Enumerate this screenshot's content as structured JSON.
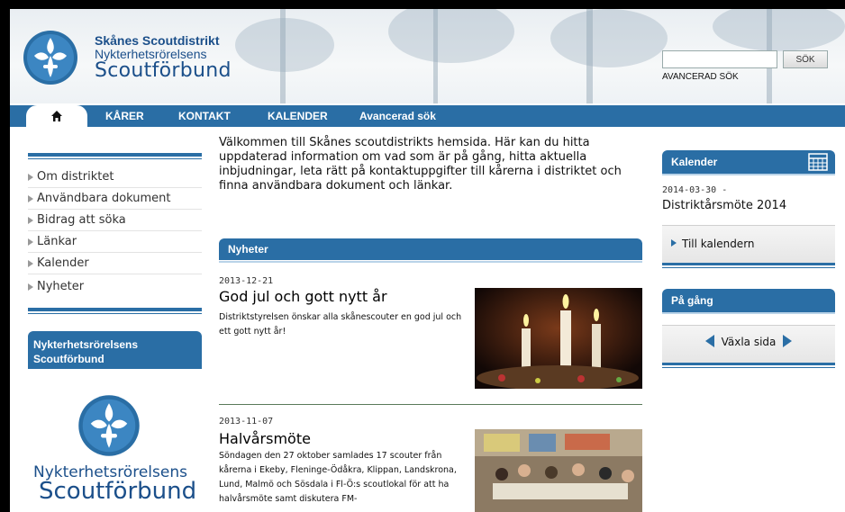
{
  "site": {
    "logo_line1": "Skånes Scoutdistrikt",
    "logo_line2": "Nykterhetsrörelsens",
    "logo_line3": "Scoutförbund"
  },
  "search": {
    "button_label": "SÖK",
    "placeholder": "",
    "advanced_label": "AVANCERAD SÖK"
  },
  "nav": {
    "home_icon": "home-icon",
    "items": [
      "KÅRER",
      "KONTAKT",
      "KALENDER",
      "Avancerad sök"
    ]
  },
  "sidebar": {
    "items": [
      "Om distriktet",
      "Användbara dokument",
      "Bidrag att söka",
      "Länkar",
      "Kalender",
      "Nyheter"
    ],
    "box_title": "Nykterhetsrörelsens Scoutförbund",
    "box_logo_line1": "Nykterhetsrörelsens",
    "box_logo_line2": "Scoutförbund"
  },
  "main": {
    "welcome": "Välkommen till Skånes scoutdistrikts hemsida. Här kan du hitta uppdaterad information om vad som är på gång, hitta aktuella inbjudningar, leta rätt på kontaktuppgifter till kårerna i distriktet och finna användbara dokument och länkar.",
    "news_header": "Nyheter",
    "news": [
      {
        "date": "2013-12-21",
        "title": "God jul och gott nytt år",
        "body": "Distriktstyrelsen önskar alla skånescouter en god jul och ett gott nytt år!"
      },
      {
        "date": "2013-11-07",
        "title": "Halvårsmöte",
        "body": "Söndagen den 27 oktober samlades 17 scouter från kårerna i Ekeby, Fleninge-Ödåkra, Klippan, Landskrona, Lund, Malmö och Sösdala i Fl-Ö:s scoutlokal för att ha halvårsmöte samt diskutera FM-"
      }
    ]
  },
  "right": {
    "calendar_title": "Kalender",
    "calendar_date": "2014-03-30 -",
    "calendar_event": "Distriktårsmöte 2014",
    "calendar_link": "Till kalendern",
    "pagang_title": "På gång",
    "pagang_link": "Växla sida"
  },
  "colors": {
    "brand_blue": "#2a6ea5",
    "logo_blue": "#1b4f8a"
  }
}
